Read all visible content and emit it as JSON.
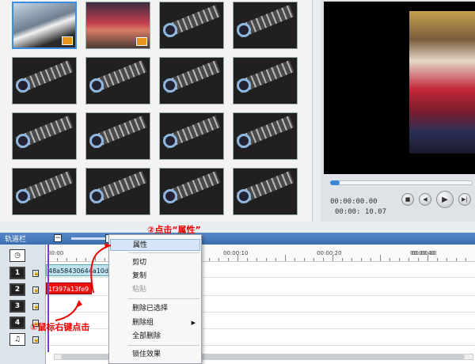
{
  "library": {
    "thumbnails": [
      {
        "kind": "photo1",
        "selected": true,
        "badge": "camera-icon"
      },
      {
        "kind": "photo2",
        "selected": false,
        "badge": "camera-icon"
      },
      {
        "kind": "film"
      },
      {
        "kind": "film"
      },
      {
        "kind": "film"
      },
      {
        "kind": "film"
      },
      {
        "kind": "film"
      },
      {
        "kind": "film"
      },
      {
        "kind": "film"
      },
      {
        "kind": "film"
      },
      {
        "kind": "film"
      },
      {
        "kind": "film"
      },
      {
        "kind": "film"
      },
      {
        "kind": "film"
      },
      {
        "kind": "film"
      },
      {
        "kind": "film"
      }
    ]
  },
  "preview": {
    "time_current": "00:00:00.00",
    "time_total": "00:00: 10.07",
    "buttons": {
      "stop": "■",
      "prev": "◀",
      "play": "▶",
      "next": "▶|"
    }
  },
  "timeline": {
    "title": "轨道栏",
    "collapse_label": "−",
    "ruler": [
      "00:00",
      "00:00:10",
      "00:00:20",
      "00:00:30",
      "00:00:40"
    ],
    "tracks": [
      {
        "icon": "clock-icon",
        "label": ""
      },
      {
        "icon": "video-track-icon",
        "label": "1"
      },
      {
        "icon": "video-track-icon",
        "label": "2"
      },
      {
        "icon": "overlay-track-icon",
        "label": "3"
      },
      {
        "icon": "overlay-track-icon",
        "label": "4"
      },
      {
        "icon": "music-note-icon",
        "label": "♫"
      }
    ],
    "clips": {
      "track1": "48a58430644a10d1",
      "track2": "1f397a13fe9"
    }
  },
  "context_menu": {
    "items": [
      "属性",
      "剪切",
      "复制",
      "粘贴",
      "删除已选择",
      "删除组",
      "全部删除",
      "锁住效果"
    ],
    "highlighted": "属性",
    "disabled": [
      "粘贴"
    ],
    "submenu": [
      "删除组"
    ]
  },
  "annotations": {
    "step1": "①鼠标右键点击",
    "step2": "②点击“属性”"
  },
  "colors": {
    "accent": "#3a6db0",
    "annotation": "#ee0000",
    "clip_red": "#ee1111",
    "clip_blue": "#bfe0ee"
  }
}
